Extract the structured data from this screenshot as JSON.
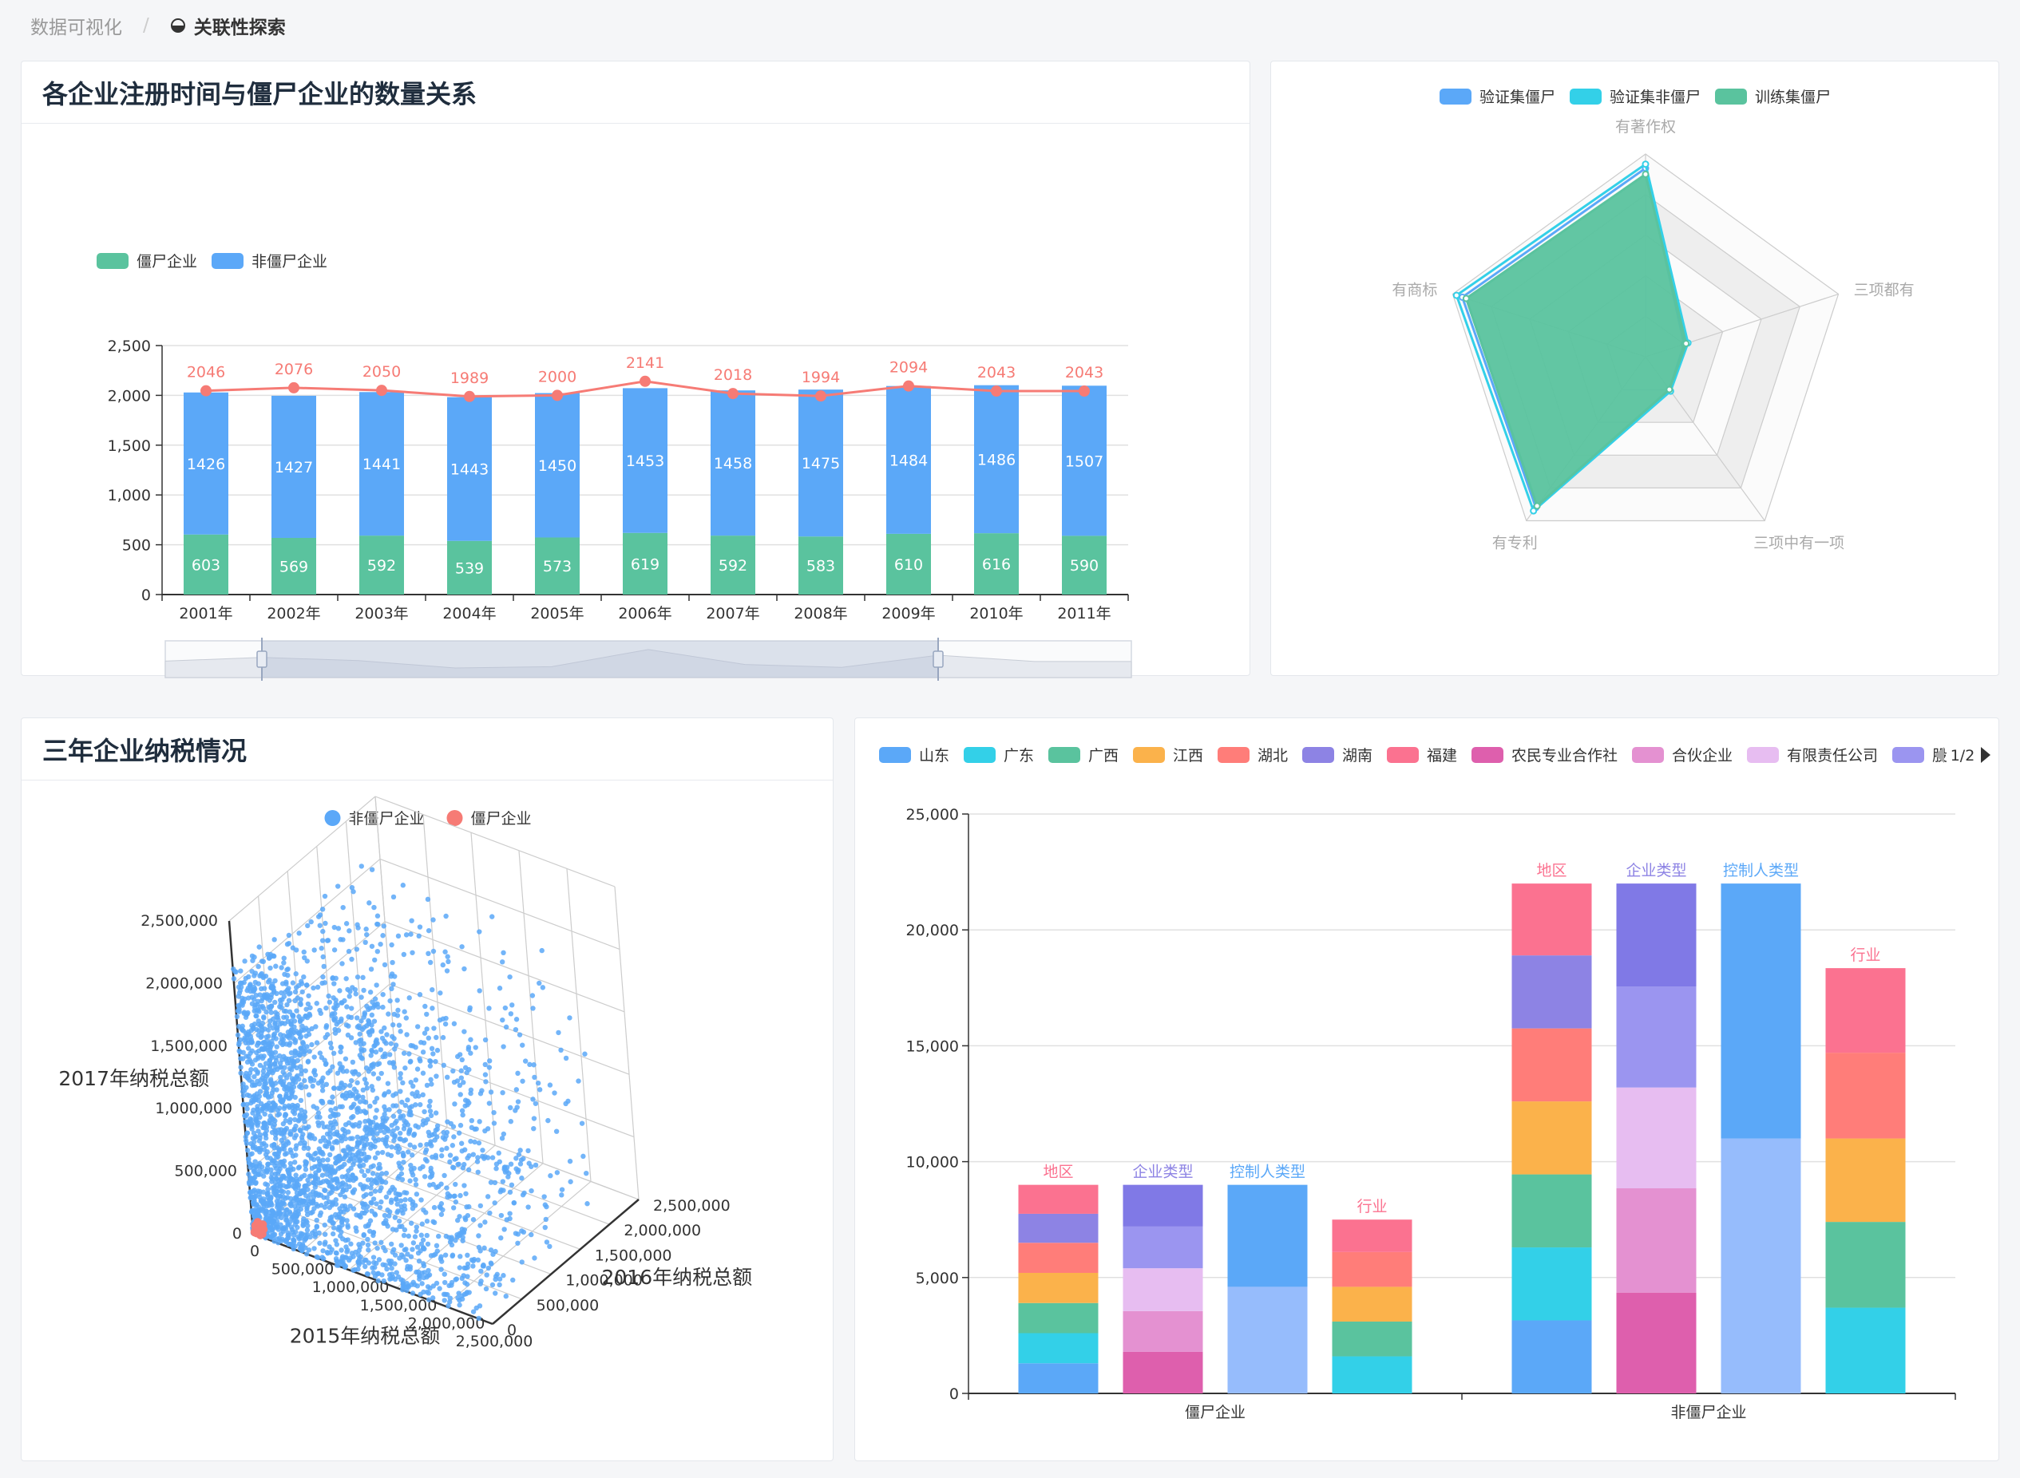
{
  "breadcrumb": {
    "root": "数据可视化",
    "separator": "/",
    "current": "关联性探索"
  },
  "colors": {
    "green": "#5ac39e",
    "blue": "#5ba8f8",
    "red": "#f67b75",
    "cyan": "#33d0e8",
    "orange": "#fbb24b",
    "salmon": "#ff7d79",
    "purple": "#8d83e4",
    "pink": "#fb7290",
    "magenta": "#de5fad",
    "lpink": "#e491d1",
    "lavender": "#e7bdf1",
    "lblue": "#96bcfc"
  },
  "chart_data": [
    {
      "id": "bar",
      "type": "bar",
      "title": "各企业注册时间与僵尸企业的数量关系",
      "categories": [
        "2001年",
        "2002年",
        "2003年",
        "2004年",
        "2005年",
        "2006年",
        "2007年",
        "2008年",
        "2009年",
        "2010年",
        "2011年"
      ],
      "series": [
        {
          "name": "僵尸企业",
          "color": "#5ac39e",
          "values": [
            603,
            569,
            592,
            539,
            573,
            619,
            592,
            583,
            610,
            616,
            590
          ]
        },
        {
          "name": "非僵尸企业",
          "color": "#5ba8f8",
          "values": [
            1426,
            1427,
            1441,
            1443,
            1450,
            1453,
            1458,
            1475,
            1484,
            1486,
            1507
          ]
        }
      ],
      "total_line": {
        "color": "#f67b75",
        "values": [
          2046,
          2076,
          2050,
          1989,
          2000,
          2141,
          2018,
          1994,
          2094,
          2043,
          2043
        ]
      },
      "ylim": [
        0,
        2500
      ],
      "yticks": [
        "0",
        "500",
        "1,000",
        "1,500",
        "2,000",
        "2,500"
      ],
      "yticks_values": [
        0,
        500,
        1000,
        1500,
        2000,
        2500
      ],
      "data_zoom": {
        "start_fraction": 0.1,
        "end_fraction": 0.8
      }
    },
    {
      "id": "radar",
      "type": "radar",
      "legend": [
        {
          "name": "验证集僵尸",
          "color": "#5ba8f8"
        },
        {
          "name": "验证集非僵尸",
          "color": "#33d0e8"
        },
        {
          "name": "训练集僵尸",
          "color": "#5ac39e"
        }
      ],
      "indicators": [
        "有著作权",
        "三项都有",
        "三项中有一项",
        "有专利",
        "有商标"
      ],
      "series": [
        {
          "name": "验证集僵尸",
          "values": [
            0.93,
            0.2,
            0.2,
            0.92,
            0.95
          ]
        },
        {
          "name": "验证集非僵尸",
          "values": [
            0.95,
            0.22,
            0.21,
            0.94,
            0.98
          ]
        },
        {
          "name": "训练集僵尸",
          "values": [
            0.9,
            0.21,
            0.2,
            0.91,
            0.93
          ]
        }
      ]
    },
    {
      "id": "scatter3d",
      "type": "scatter",
      "title": "三年企业纳税情况",
      "legend": [
        {
          "name": "非僵尸企业",
          "color": "#5ba8f8"
        },
        {
          "name": "僵尸企业",
          "color": "#f67b75"
        }
      ],
      "x_label": "2015年纳税总额",
      "y_label": "2016年纳税总额",
      "z_label": "2017年纳税总额",
      "axis_max": 2500000,
      "x_ticks": [
        "0",
        "500,000",
        "1,000,000",
        "1,500,000",
        "2,000,000",
        "2,500,000"
      ],
      "y_ticks": [
        "0",
        "500,000",
        "1,000,000",
        "1,500,000",
        "2,000,000",
        "2,500,000"
      ],
      "z_ticks": [
        "0",
        "500,000",
        "1,000,000",
        "1,500,000",
        "2,000,000",
        "2,500,000"
      ]
    },
    {
      "id": "stacked",
      "type": "bar",
      "legend": [
        {
          "name": "山东",
          "color": "#5ba8f8"
        },
        {
          "name": "广东",
          "color": "#33d0e8"
        },
        {
          "name": "广西",
          "color": "#5ac39e"
        },
        {
          "name": "江西",
          "color": "#fbb24b"
        },
        {
          "name": "湖北",
          "color": "#ff7d79"
        },
        {
          "name": "湖南",
          "color": "#8d83e4"
        },
        {
          "name": "福建",
          "color": "#fb7290"
        },
        {
          "name": "农民专业合作社",
          "color": "#de5fad"
        },
        {
          "name": "合伙企业",
          "color": "#e491d1"
        },
        {
          "name": "有限责任公司",
          "color": "#e7bdf1"
        },
        {
          "name": "股",
          "color": "#9b95f0"
        }
      ],
      "legend_page": "1/2",
      "categories": [
        "僵尸企业",
        "非僵尸企业"
      ],
      "ylim": [
        0,
        25000
      ],
      "yticks": [
        "0",
        "5,000",
        "10,000",
        "15,000",
        "20,000",
        "25,000"
      ],
      "yticks_values": [
        0,
        5000,
        10000,
        15000,
        20000,
        25000
      ],
      "groups": [
        {
          "category": "僵尸企业",
          "stacks": [
            {
              "label": "地区",
              "label_color": "#fb7290",
              "segments": [
                {
                  "color": "#5ba8f8",
                  "value": 1300
                },
                {
                  "color": "#33d0e8",
                  "value": 1300
                },
                {
                  "color": "#5ac39e",
                  "value": 1300
                },
                {
                  "color": "#fbb24b",
                  "value": 1300
                },
                {
                  "color": "#ff7d79",
                  "value": 1300
                },
                {
                  "color": "#8d83e4",
                  "value": 1250
                },
                {
                  "color": "#fb7290",
                  "value": 1250
                }
              ]
            },
            {
              "label": "企业类型",
              "label_color": "#8d83e4",
              "segments": [
                {
                  "color": "#de5fad",
                  "value": 1800
                },
                {
                  "color": "#e491d1",
                  "value": 1750
                },
                {
                  "color": "#e7bdf1",
                  "value": 1850
                },
                {
                  "color": "#9b95f0",
                  "value": 1800
                },
                {
                  "color": "#8079e6",
                  "value": 1800
                }
              ]
            },
            {
              "label": "控制人类型",
              "label_color": "#5ba8f8",
              "segments": [
                {
                  "color": "#96bcfc",
                  "value": 4600
                },
                {
                  "color": "#5ba8f8",
                  "value": 4400
                }
              ]
            },
            {
              "label": "行业",
              "label_color": "#fb7290",
              "segments": [
                {
                  "color": "#33d0e8",
                  "value": 1600
                },
                {
                  "color": "#5ac39e",
                  "value": 1500
                },
                {
                  "color": "#fbb24b",
                  "value": 1500
                },
                {
                  "color": "#ff7d79",
                  "value": 1500
                },
                {
                  "color": "#fb7290",
                  "value": 1400
                }
              ]
            }
          ]
        },
        {
          "category": "非僵尸企业",
          "stacks": [
            {
              "label": "地区",
              "label_color": "#fb7290",
              "segments": [
                {
                  "color": "#5ba8f8",
                  "value": 3150
                },
                {
                  "color": "#33d0e8",
                  "value": 3150
                },
                {
                  "color": "#5ac39e",
                  "value": 3150
                },
                {
                  "color": "#fbb24b",
                  "value": 3150
                },
                {
                  "color": "#ff7d79",
                  "value": 3150
                },
                {
                  "color": "#8d83e4",
                  "value": 3150
                },
                {
                  "color": "#fb7290",
                  "value": 3100
                }
              ]
            },
            {
              "label": "企业类型",
              "label_color": "#8d83e4",
              "segments": [
                {
                  "color": "#de5fad",
                  "value": 4350
                },
                {
                  "color": "#e491d1",
                  "value": 4500
                },
                {
                  "color": "#e7bdf1",
                  "value": 4350
                },
                {
                  "color": "#9b95f0",
                  "value": 4350
                },
                {
                  "color": "#8079e6",
                  "value": 4450
                }
              ]
            },
            {
              "label": "控制人类型",
              "label_color": "#5ba8f8",
              "segments": [
                {
                  "color": "#96bcfc",
                  "value": 11000
                },
                {
                  "color": "#5ba8f8",
                  "value": 11000
                }
              ]
            },
            {
              "label": "行业",
              "label_color": "#fb7290",
              "segments": [
                {
                  "color": "#33d0e8",
                  "value": 3700
                },
                {
                  "color": "#5ac39e",
                  "value": 3700
                },
                {
                  "color": "#fbb24b",
                  "value": 3600
                },
                {
                  "color": "#ff7d79",
                  "value": 3700
                },
                {
                  "color": "#fb7290",
                  "value": 3650
                }
              ]
            }
          ]
        }
      ]
    }
  ]
}
